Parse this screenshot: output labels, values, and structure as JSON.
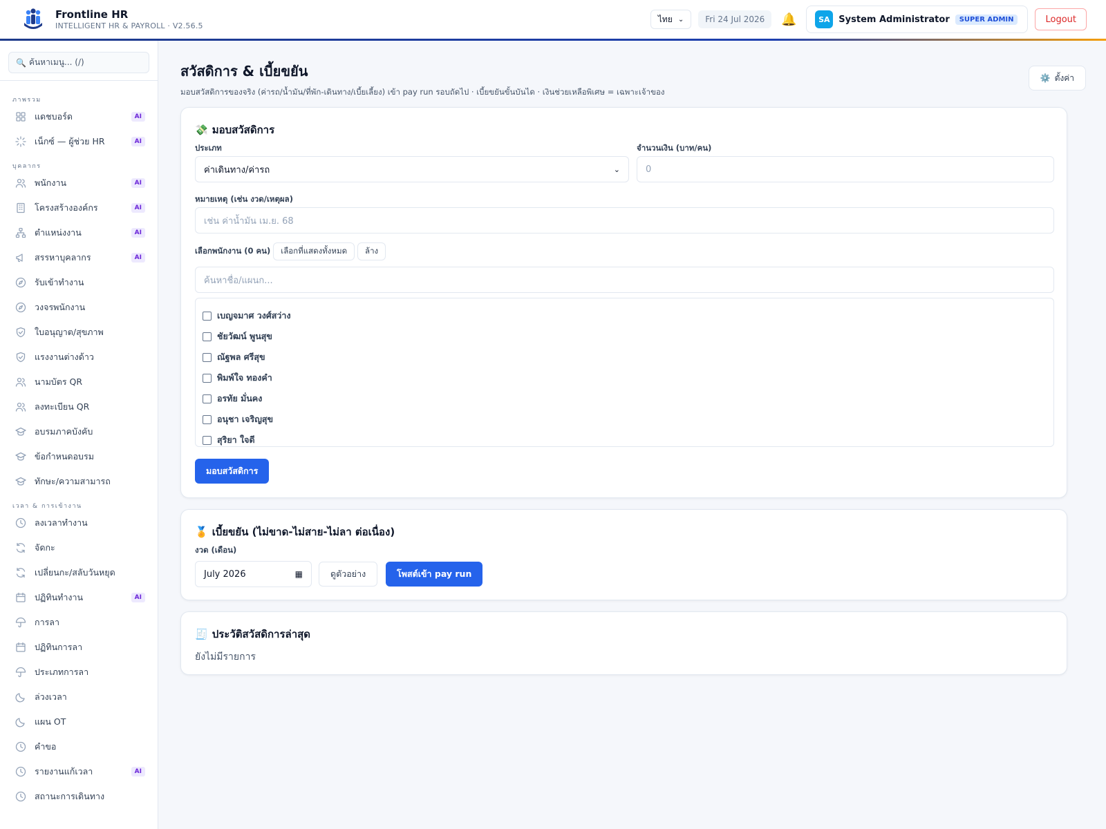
{
  "header": {
    "brand_title": "Frontline HR",
    "brand_sub": "INTELLIGENT HR & PAYROLL · V2.56.5",
    "language": "ไทย",
    "date": "Fri 24 Jul 2026",
    "user_initials": "SA",
    "user_name": "System Administrator",
    "role_badge": "SUPER ADMIN",
    "logout_label": "Logout"
  },
  "sidebar": {
    "search_placeholder": "ค้นหาเมนู... (/)",
    "sections": [
      {
        "label": "ภาพรวม",
        "items": [
          {
            "label": "แดชบอร์ด",
            "icon": "grid-icon",
            "ai": true
          },
          {
            "label": "เน็กซ์ — ผู้ช่วย HR",
            "icon": "sparkle-icon",
            "ai": true
          }
        ]
      },
      {
        "label": "บุคลากร",
        "items": [
          {
            "label": "พนักงาน",
            "icon": "users-icon",
            "ai": true
          },
          {
            "label": "โครงสร้างองค์กร",
            "icon": "building-icon",
            "ai": true
          },
          {
            "label": "ตำแหน่งงาน",
            "icon": "hierarchy-icon",
            "ai": true
          },
          {
            "label": "สรรหาบุคลากร",
            "icon": "megaphone-icon",
            "ai": true
          },
          {
            "label": "รับเข้าทำงาน",
            "icon": "compass-icon",
            "ai": false
          },
          {
            "label": "วงจรพนักงาน",
            "icon": "compass-icon",
            "ai": false
          },
          {
            "label": "ใบอนุญาต/สุขภาพ",
            "icon": "shield-icon",
            "ai": false
          },
          {
            "label": "แรงงานต่างด้าว",
            "icon": "shield-icon",
            "ai": false
          },
          {
            "label": "นามบัตร QR",
            "icon": "users-icon",
            "ai": false
          },
          {
            "label": "ลงทะเบียน QR",
            "icon": "users-icon",
            "ai": false
          },
          {
            "label": "อบรมภาคบังคับ",
            "icon": "graduation-cap-icon",
            "ai": false
          },
          {
            "label": "ข้อกำหนดอบรม",
            "icon": "graduation-cap-icon",
            "ai": false
          },
          {
            "label": "ทักษะ/ความสามารถ",
            "icon": "graduation-cap-icon",
            "ai": false
          }
        ]
      },
      {
        "label": "เวลา & การเข้างาน",
        "items": [
          {
            "label": "ลงเวลาทำงาน",
            "icon": "clock-icon",
            "ai": false
          },
          {
            "label": "จัดกะ",
            "icon": "refresh-icon",
            "ai": false
          },
          {
            "label": "เปลี่ยนกะ/สลับวันหยุด",
            "icon": "refresh-icon",
            "ai": false
          },
          {
            "label": "ปฏิทินทำงาน",
            "icon": "calendar-icon",
            "ai": true
          },
          {
            "label": "การลา",
            "icon": "umbrella-icon",
            "ai": false
          },
          {
            "label": "ปฏิทินการลา",
            "icon": "calendar-icon",
            "ai": false
          },
          {
            "label": "ประเภทการลา",
            "icon": "umbrella-icon",
            "ai": false
          },
          {
            "label": "ล่วงเวลา",
            "icon": "moon-icon",
            "ai": false
          },
          {
            "label": "แผน OT",
            "icon": "moon-icon",
            "ai": false
          },
          {
            "label": "คำขอ",
            "icon": "clock-icon",
            "ai": false
          },
          {
            "label": "รายงานแก้เวลา",
            "icon": "clock-icon",
            "ai": true
          },
          {
            "label": "สถานะการเดินทาง",
            "icon": "clock-icon",
            "ai": false
          }
        ]
      }
    ],
    "ai_badge": "AI"
  },
  "page": {
    "title": "สวัสดิการ & เบี้ยขยัน",
    "subtitle": "มอบสวัสดิการของจริง (ค่ารถ/น้ำมัน/ที่พัก-เดินทาง/เบี้ยเลี้ยง) เข้า pay run รอบถัดไป · เบี้ยขยันขั้นบันได · เงินช่วยเหลือพิเศษ = เฉพาะเจ้าของ",
    "settings_label": "ตั้งค่า"
  },
  "grant_card": {
    "emoji": "💸",
    "title": "มอบสวัสดิการ",
    "type_label": "ประเภท",
    "type_value": "ค่าเดินทาง/ค่ารถ",
    "amount_label": "จำนวนเงิน (บาท/คน)",
    "amount_placeholder": "0",
    "note_label": "หมายเหตุ (เช่น งวด/เหตุผล)",
    "note_placeholder": "เช่น ค่าน้ำมัน เม.ย. 68",
    "select_label": "เลือกพนักงาน (0 คน)",
    "select_all_label": "เลือกที่แสดงทั้งหมด",
    "clear_label": "ล้าง",
    "search_placeholder": "ค้นหาชื่อ/แผนก...",
    "employees": [
      "เบญจมาศ วงศ์สว่าง",
      "ชัยวัฒน์ พูนสุข",
      "ณัฐพล ศรีสุข",
      "พิมพ์ใจ ทองคำ",
      "อรทัย มั่นคง",
      "อนุชา เจริญสุข",
      "สุริยา ใจดี"
    ],
    "submit_label": "มอบสวัสดิการ"
  },
  "diligence_card": {
    "emoji": "🏅",
    "title": "เบี้ยขยัน (ไม่ขาด-ไม่สาย-ไม่ลา ต่อเนื่อง)",
    "period_label": "งวด (เดือน)",
    "period_value": "July 2026",
    "preview_label": "ดูตัวอย่าง",
    "post_label": "โพสต์เข้า pay run"
  },
  "history_card": {
    "emoji": "🧾",
    "title": "ประวัติสวัสดิการล่าสุด",
    "empty_text": "ยังไม่มีรายการ"
  }
}
